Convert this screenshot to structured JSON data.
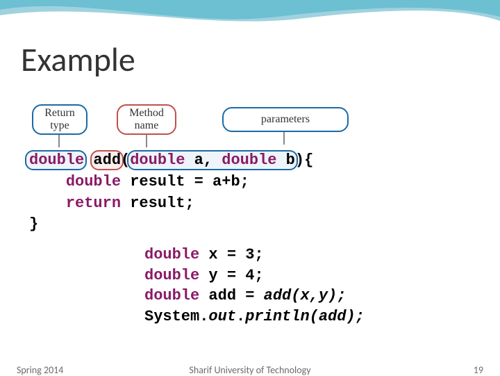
{
  "title": "Example",
  "labels": {
    "return_type": "Return\ntype",
    "method_name": "Method\nname",
    "parameters": "parameters"
  },
  "code": {
    "kw_double": "double",
    "fn_name": "add",
    "params_text": "double a, double b",
    "line1_suffix": "){",
    "line2_pre": "    ",
    "line2_kw": "double",
    "line2_rest": " result = a+b;",
    "line3_pre": "    ",
    "line3_kw": "return",
    "line3_rest": " result;",
    "line4": "}"
  },
  "code2": {
    "l1_kw": "double",
    "l1_rest": " x = 3;",
    "l2_kw": "double",
    "l2_rest": " y = 4;",
    "l3_kw": "double",
    "l3_rest_a": " add = ",
    "l3_rest_b": "add(x,y);",
    "l4_a": "System.",
    "l4_out": "out",
    "l4_b": ".",
    "l4_println": "println(add);"
  },
  "footer": {
    "left": "Spring 2014",
    "center": "Sharif University of Technology",
    "right": "19"
  }
}
